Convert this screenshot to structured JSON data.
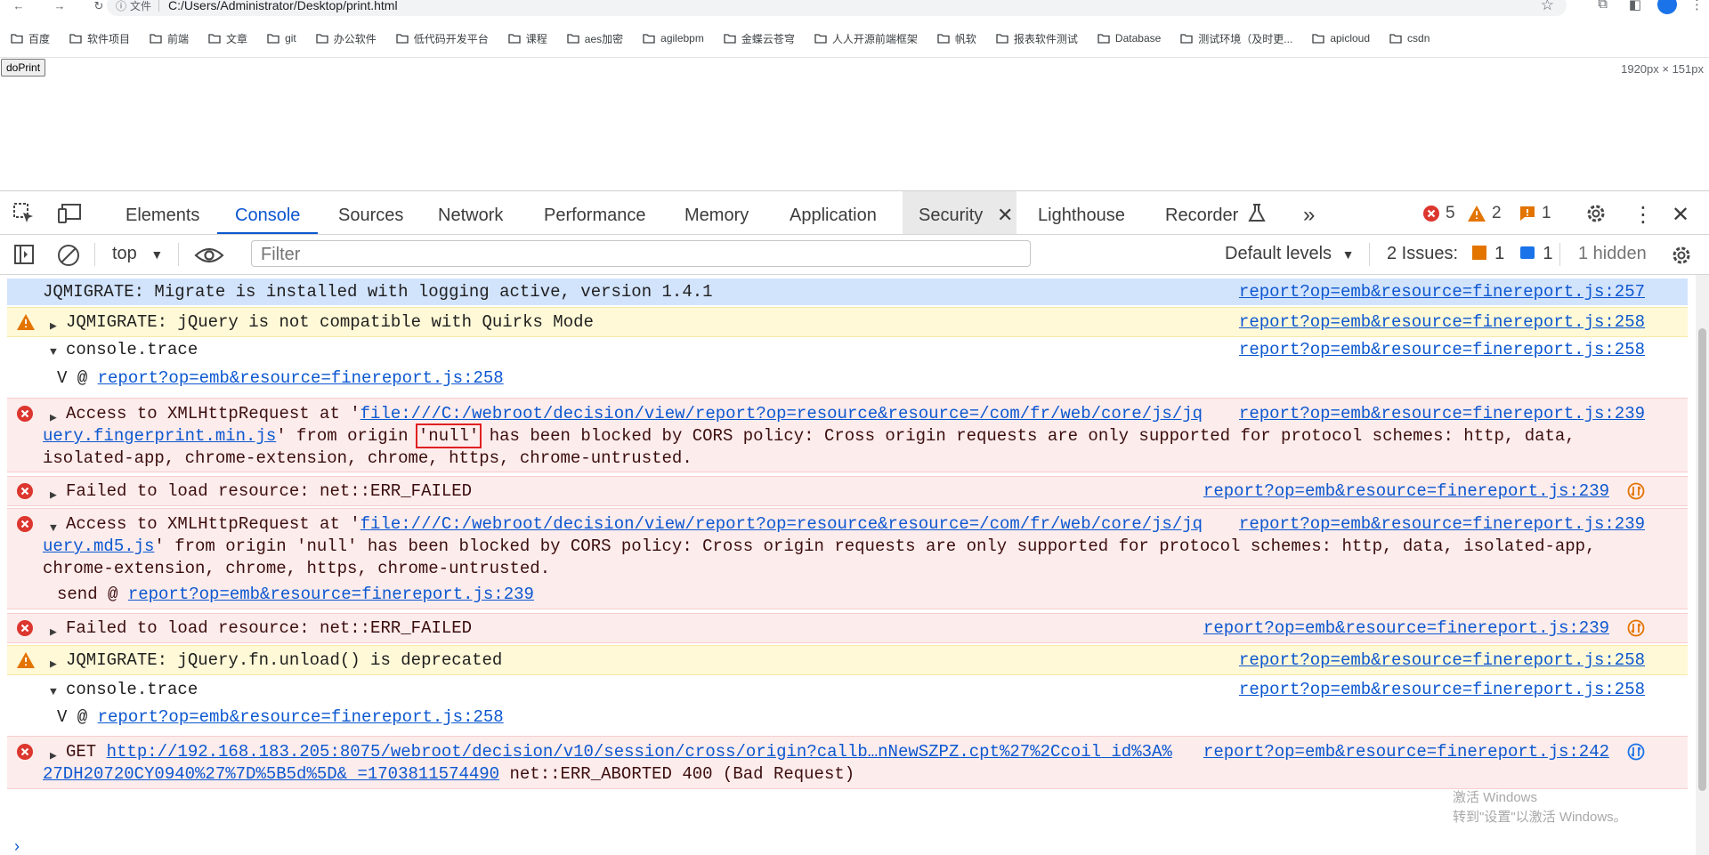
{
  "browser": {
    "file_label": "文件",
    "url": "C:/Users/Administrator/Desktop/print.html",
    "bookmarks": [
      "百度",
      "软件项目",
      "前端",
      "文章",
      "git",
      "办公软件",
      "低代码开发平台",
      "课程",
      "aes加密",
      "agilebpm",
      "金蝶云苍穹",
      "人人开源前端框架",
      "帆软",
      "报表软件测试",
      "Database",
      "测试环境（及时更...",
      "apicloud",
      "csdn"
    ]
  },
  "page": {
    "doprint_label": "doPrint",
    "dimensions": "1920px × 151px"
  },
  "devtools": {
    "tabs": [
      "Elements",
      "Console",
      "Sources",
      "Network",
      "Performance",
      "Memory",
      "Application",
      "Security",
      "Lighthouse",
      "Recorder"
    ],
    "active_tab": "Console",
    "counters": {
      "errors": "5",
      "warnings": "2",
      "info": "1"
    },
    "toolbar": {
      "context": "top",
      "filter_placeholder": "Filter",
      "levels": "Default levels",
      "issues_label": "2 Issues:",
      "issues_warn": "1",
      "issues_info": "1",
      "hidden": "1 hidden"
    },
    "colors": {
      "accent": "#0b57d0",
      "error": "#dc362e",
      "warning": "#e37400"
    }
  },
  "console": {
    "m1": {
      "text": "JQMIGRATE: Migrate is installed with logging active, version 1.4.1",
      "src": "report?op=emb&resource=finereport.js:257"
    },
    "m2": {
      "text": "JQMIGRATE: jQuery is not compatible with Quirks Mode",
      "src": "report?op=emb&resource=finereport.js:258"
    },
    "m3": {
      "text": "console.trace",
      "src": "report?op=emb&resource=finereport.js:258",
      "frame_prefix": "V @ ",
      "frame_link": "report?op=emb&resource=finereport.js:258"
    },
    "m4": {
      "prefix": "Access to XMLHttpRequest at '",
      "link1": "file:///C:/webroot/decision/view/report?op=resource&resource=/com/fr/web/core/js/jq",
      "link2": "uery.fingerprint.min.js",
      "mid": "' from origin ",
      "origin": "'null'",
      "rest1": " has been blocked by CORS policy: Cross origin requests are only supported for protocol schemes: http, data,",
      "rest2": "isolated-app, chrome-extension, chrome, https, chrome-untrusted.",
      "src": "report?op=emb&resource=finereport.js:239"
    },
    "m5": {
      "text": "Failed to load resource: net::ERR_FAILED",
      "src": "report?op=emb&resource=finereport.js:239"
    },
    "m6": {
      "prefix": "Access to XMLHttpRequest at '",
      "link1": "file:///C:/webroot/decision/view/report?op=resource&resource=/com/fr/web/core/js/jq",
      "link2": "uery.md5.js",
      "rest1": "' from origin 'null' has been blocked by CORS policy: Cross origin requests are only supported for protocol schemes: http, data, isolated-app,",
      "rest2": "chrome-extension, chrome, https, chrome-untrusted.",
      "frame_prefix": "send @ ",
      "frame_link": "report?op=emb&resource=finereport.js:239",
      "src": "report?op=emb&resource=finereport.js:239"
    },
    "m7": {
      "text": "Failed to load resource: net::ERR_FAILED",
      "src": "report?op=emb&resource=finereport.js:239"
    },
    "m8": {
      "text": "JQMIGRATE: jQuery.fn.unload() is deprecated",
      "src": "report?op=emb&resource=finereport.js:258"
    },
    "m9": {
      "text": "console.trace",
      "src": "report?op=emb&resource=finereport.js:258",
      "frame_prefix": "V @ ",
      "frame_link": "report?op=emb&resource=finereport.js:258"
    },
    "m10": {
      "prefix": "GET ",
      "link1": "http://192.168.183.205:8075/webroot/decision/v10/session/cross/origin?callb…nNewSZPZ.cpt%27%2Ccoil_id%3A%",
      "link2": "27DH20720CY0940%27%7D%5B5d%5D&_=1703811574490",
      "rest": " net::ERR_ABORTED 400 (Bad Request)",
      "src": "report?op=emb&resource=finereport.js:242"
    }
  },
  "watermark": {
    "line1": "激活 Windows",
    "line2": "转到\"设置\"以激活 Windows。"
  }
}
